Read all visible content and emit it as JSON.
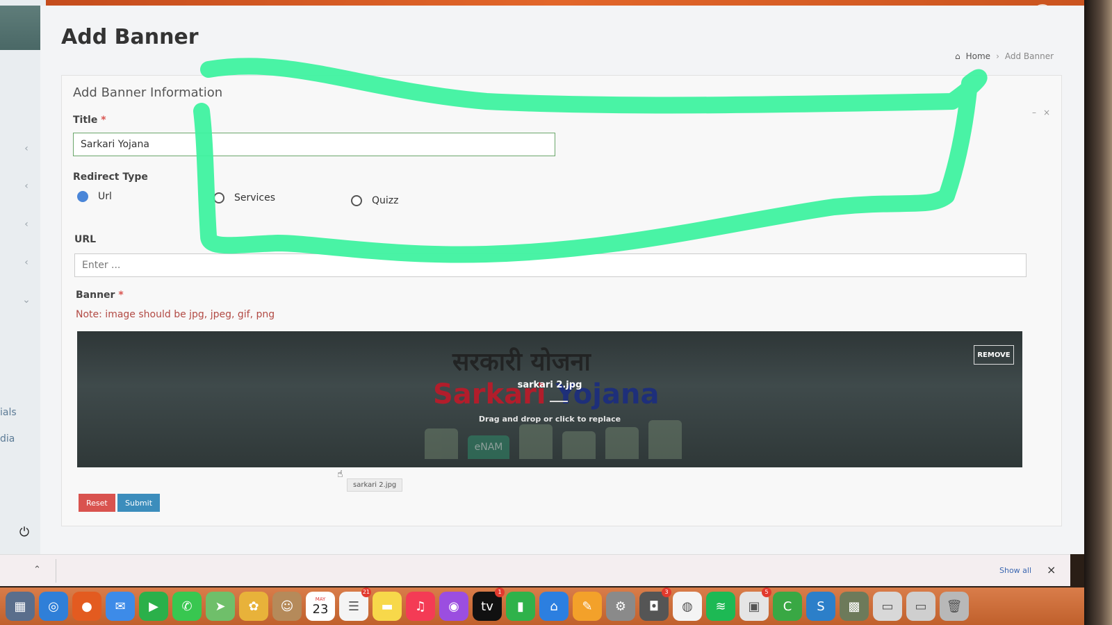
{
  "header": {
    "page_title": "Add Banner",
    "breadcrumb": {
      "home": "Home",
      "current": "Add Banner"
    }
  },
  "sidebar": {
    "partial_labels": [
      "ials",
      "dia"
    ]
  },
  "card": {
    "title": "Add Banner Information",
    "tools": {
      "minimize": "–",
      "close": "×"
    }
  },
  "form": {
    "title_label": "Title",
    "required_mark": "*",
    "title_value": "Sarkari Yojana",
    "redirect_label": "Redirect Type",
    "redirect_options": [
      {
        "label": "Url",
        "checked": true
      },
      {
        "label": "Services",
        "checked": false
      },
      {
        "label": "Quizz",
        "checked": false
      }
    ],
    "url_label": "URL",
    "url_placeholder": "Enter ...",
    "banner_label": "Banner",
    "banner_note": "Note: image should be jpg, jpeg, gif, png"
  },
  "dropzone": {
    "image_text_hindi": "सरकारी योजना",
    "image_text_en_1": "Sarkari",
    "image_text_en_2": "Yojana",
    "image_badge": "eNAM",
    "file_name": "sarkari 2.jpg",
    "drag_text": "Drag and drop or click to replace",
    "remove_label": "REMOVE",
    "tooltip": "sarkari 2.jpg"
  },
  "buttons": {
    "reset": "Reset",
    "submit": "Submit"
  },
  "downloads_bar": {
    "show_all": "Show all",
    "close": "×"
  },
  "dock": {
    "apps": [
      {
        "name": "launchpad-icon",
        "color": "#5a6e8c"
      },
      {
        "name": "safari-icon",
        "color": "#2f7fd8"
      },
      {
        "name": "firefox-icon",
        "color": "#e35b20"
      },
      {
        "name": "mail-icon",
        "color": "#3d8be8"
      },
      {
        "name": "facetime-icon",
        "color": "#2bb04a"
      },
      {
        "name": "messages-icon",
        "color": "#38c750"
      },
      {
        "name": "maps-icon",
        "color": "#6fbf6a"
      },
      {
        "name": "photos-icon",
        "color": "#e8b23a"
      },
      {
        "name": "contacts-icon",
        "color": "#b58a5a"
      },
      {
        "name": "calendar-icon",
        "color": "#ffffff"
      },
      {
        "name": "reminders-icon",
        "color": "#f4f4f4"
      },
      {
        "name": "notes-icon",
        "color": "#f7d84a"
      },
      {
        "name": "music-icon",
        "color": "#f43b55"
      },
      {
        "name": "podcasts-icon",
        "color": "#9b4ee0"
      },
      {
        "name": "tv-icon",
        "color": "#111111"
      },
      {
        "name": "numbers-icon",
        "color": "#2fb24a"
      },
      {
        "name": "keynote-icon",
        "color": "#2c7fe0"
      },
      {
        "name": "pages-icon",
        "color": "#f3a12a"
      },
      {
        "name": "settings-icon",
        "color": "#8a8a8a"
      },
      {
        "name": "screenshot-icon",
        "color": "#555555"
      },
      {
        "name": "chrome-icon",
        "color": "#f4f4f4"
      },
      {
        "name": "spotify-icon",
        "color": "#1db954"
      },
      {
        "name": "office-icon",
        "color": "#e5e5e5"
      },
      {
        "name": "camtasia-icon",
        "color": "#39a844"
      },
      {
        "name": "scrivener-icon",
        "color": "#2c7fc9"
      },
      {
        "name": "preview-icon",
        "color": "#6d7a5a"
      },
      {
        "name": "downloads-stack-icon",
        "color": "#d8d8d8"
      },
      {
        "name": "folder-stack-icon",
        "color": "#cfcfcf"
      },
      {
        "name": "trash-icon",
        "color": "#b8b8b8"
      }
    ],
    "calendar": {
      "month": "MAY",
      "day": "23"
    },
    "badges": {
      "reminders": "21",
      "tv": "1",
      "screenshot": "3",
      "office": "5"
    }
  },
  "colors": {
    "topbar": "#e2662a",
    "highlight_marker": "#3ff2a0",
    "reset": "#d9534f",
    "submit": "#3c8dbc",
    "note": "#b24a44"
  }
}
